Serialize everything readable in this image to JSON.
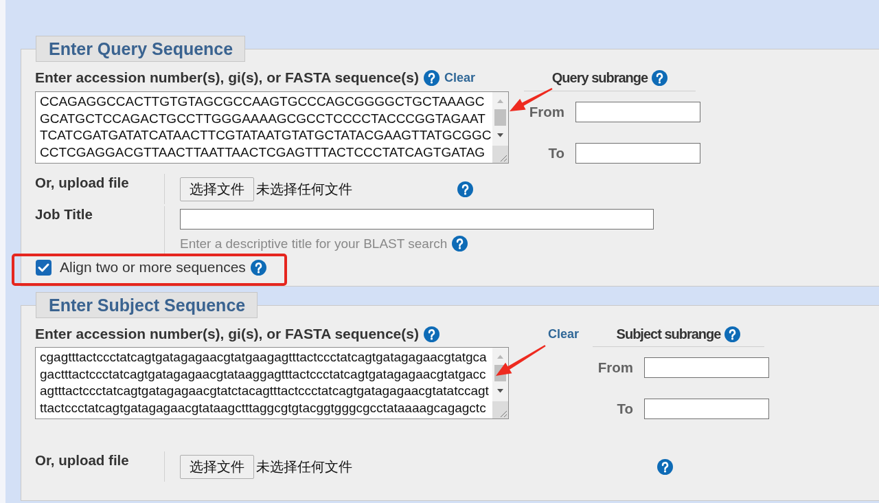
{
  "query_section": {
    "legend": "Enter Query Sequence",
    "sequence_label": "Enter accession number(s), gi(s), or FASTA sequence(s)",
    "clear_link": "Clear",
    "sequence_lines": [
      "CCAGAGGCCACTTGTGTAGCGCCAAGTGCCCAGCGGGGCTGCTAAAGC",
      "GCATGCTCCAGACTGCCTTGGGAAAAGCGCCTCCCCTACCCGGTAGAAT",
      "TCATCGATGATATCATAACTTCGTATAATGTATGCTATACGAAGTTATGCGGC",
      "CCTCGAGGACGTTAACTTAATTAACTCGAGTTTACTCCCTATCAGTGATAG"
    ],
    "subrange": {
      "title": "Query subrange",
      "from_label": "From",
      "to_label": "To"
    },
    "upload": {
      "label": "Or, upload file",
      "button": "选择文件",
      "file_status": "未选择任何文件"
    },
    "job_title": {
      "label": "Job Title",
      "hint": "Enter a descriptive title for your BLAST search"
    },
    "align_option": {
      "label": "Align two or more sequences",
      "checked": true
    }
  },
  "subject_section": {
    "legend": "Enter Subject Sequence",
    "sequence_label": "Enter accession number(s), gi(s), or FASTA sequence(s)",
    "clear_link": "Clear",
    "sequence_lines": [
      "cgagtttactccctatcagtgatagagaacgtatgaagagtttactccctatcagtgatagagaacgtatgca",
      "gactttactccctatcagtgatagagaacgtataaggagtttactccctatcagtgatagagaacgtatgacc",
      "agtttactccctatcagtgatagagaacgtatctacagtttactccctatcagtgatagagaacgtatatccagt",
      "ttactccctatcagtgatagagaacgtataagctttaggcgtgtacggtgggcgcctataaaagcagagctc"
    ],
    "subrange": {
      "title": "Subject subrange",
      "from_label": "From",
      "to_label": "To"
    },
    "upload": {
      "label": "Or, upload file",
      "button": "选择文件",
      "file_status": "未选择任何文件"
    }
  }
}
